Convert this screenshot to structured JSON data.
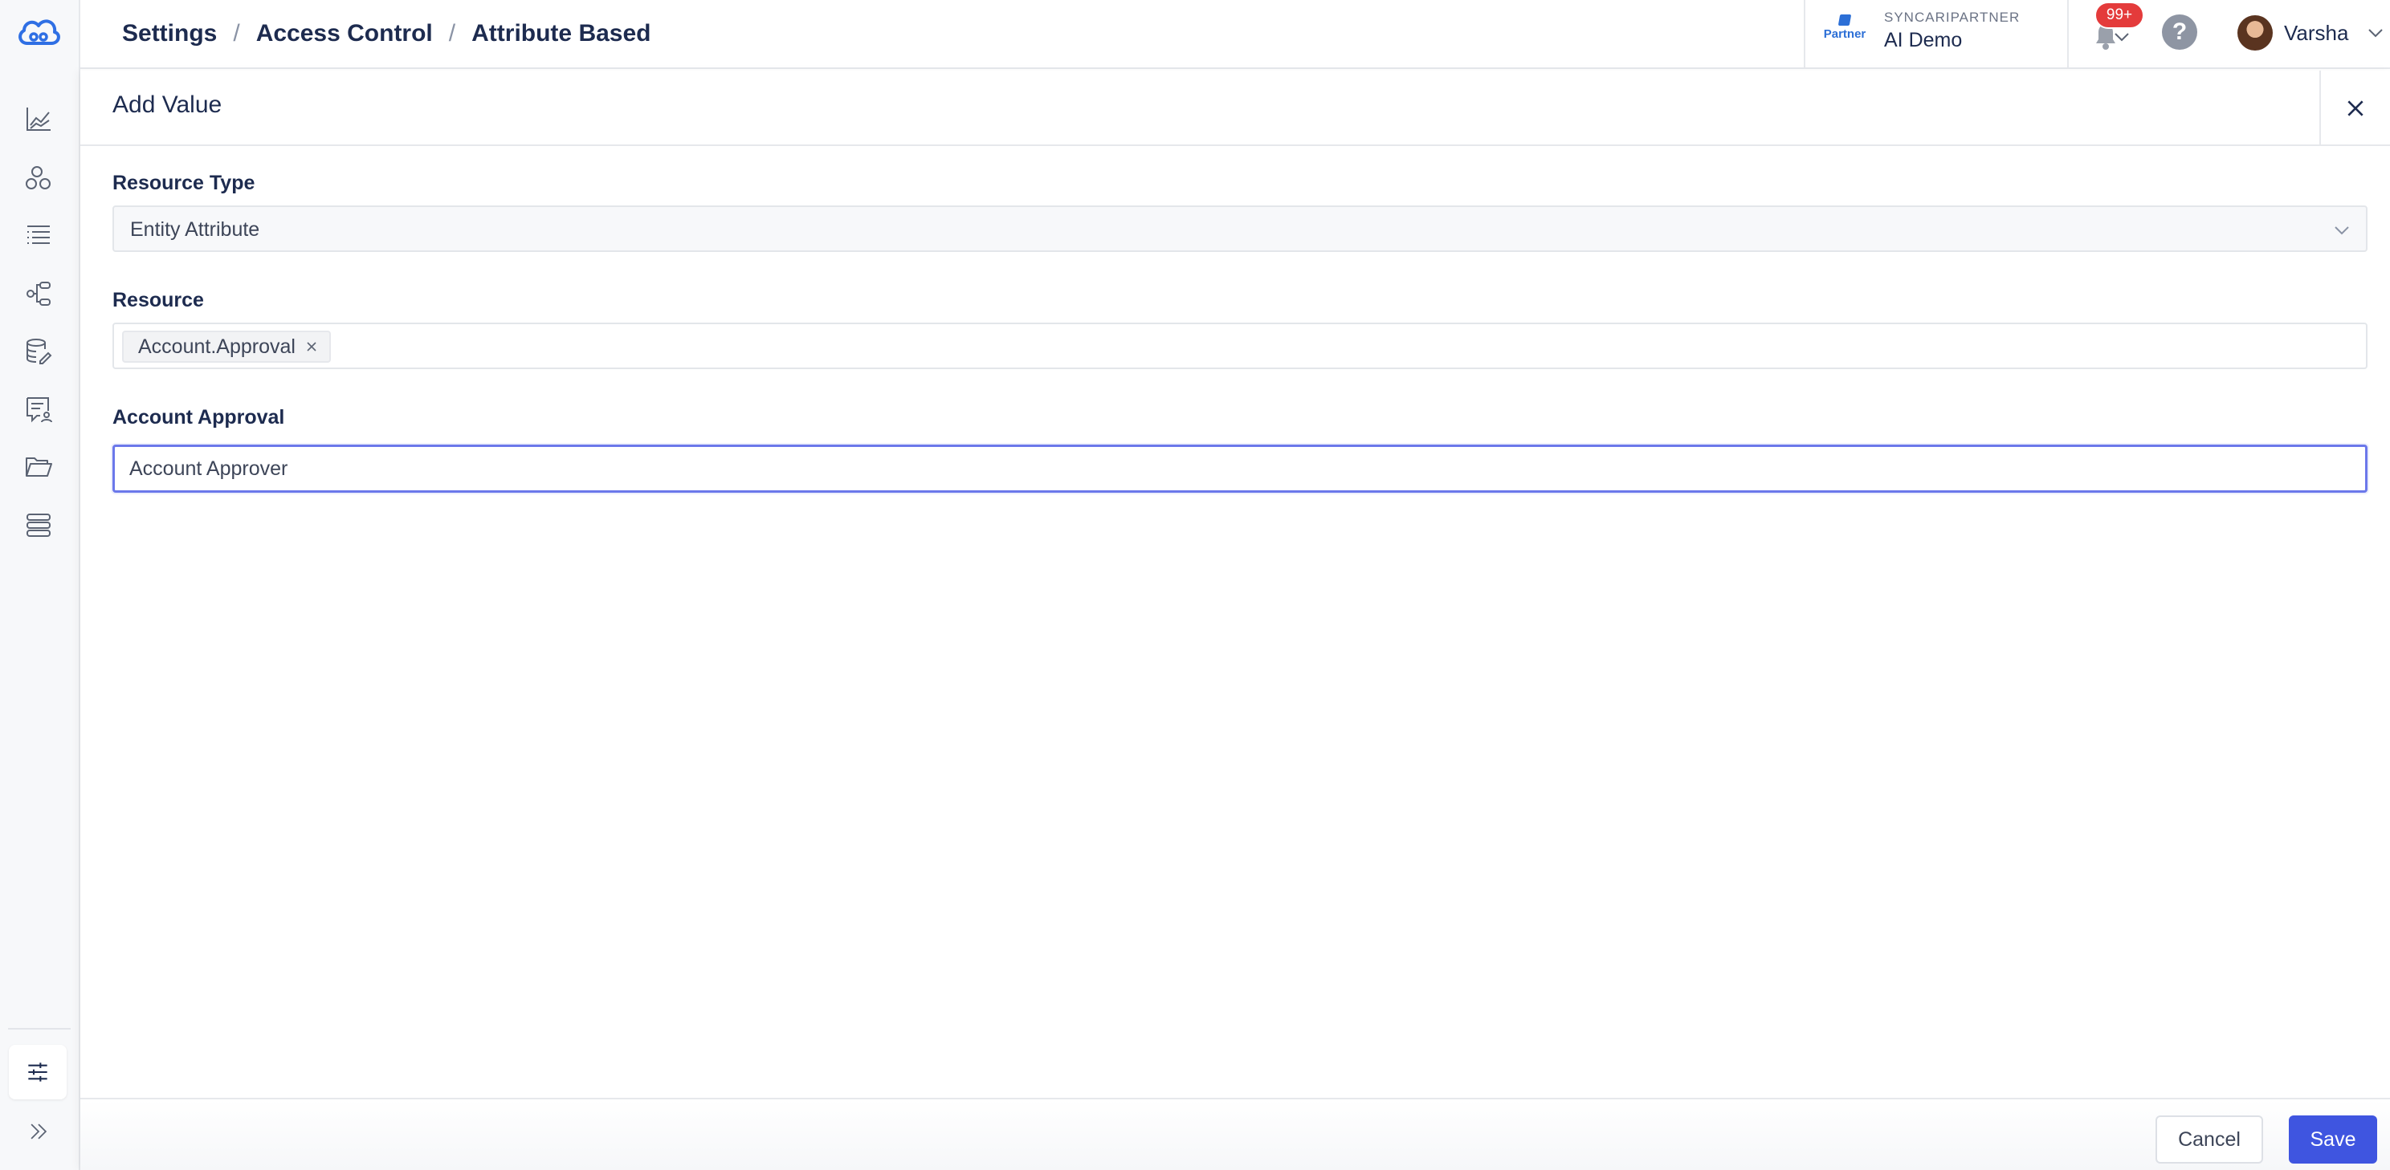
{
  "breadcrumb": [
    "Settings",
    "Access Control",
    "Attribute Based"
  ],
  "org": {
    "partner_label": "Partner",
    "label": "SYNCARIPARTNER",
    "name": "AI Demo"
  },
  "notifications": {
    "badge": "99+"
  },
  "help": {
    "label": "?"
  },
  "user": {
    "name": "Varsha"
  },
  "sidebar": {
    "items": [
      {
        "icon": "chart-icon"
      },
      {
        "icon": "entities-icon"
      },
      {
        "icon": "list-icon"
      },
      {
        "icon": "pipeline-icon"
      },
      {
        "icon": "database-edit-icon"
      },
      {
        "icon": "chat-user-icon"
      },
      {
        "icon": "folder-icon"
      },
      {
        "icon": "stack-icon"
      }
    ],
    "bottom": [
      {
        "icon": "sliders-icon"
      },
      {
        "icon": "double-chevron-right-icon"
      }
    ]
  },
  "panel": {
    "title": "Add Value",
    "resource_type": {
      "label": "Resource Type",
      "value": "Entity Attribute"
    },
    "resource": {
      "label": "Resource",
      "tags": [
        "Account.Approval"
      ]
    },
    "account_approval": {
      "label": "Account Approval",
      "value": "Account Approver"
    },
    "cancel_label": "Cancel",
    "save_label": "Save"
  },
  "colors": {
    "accent": "#3f55e0",
    "badge": "#e43b3b",
    "focus": "#6b78ea"
  }
}
